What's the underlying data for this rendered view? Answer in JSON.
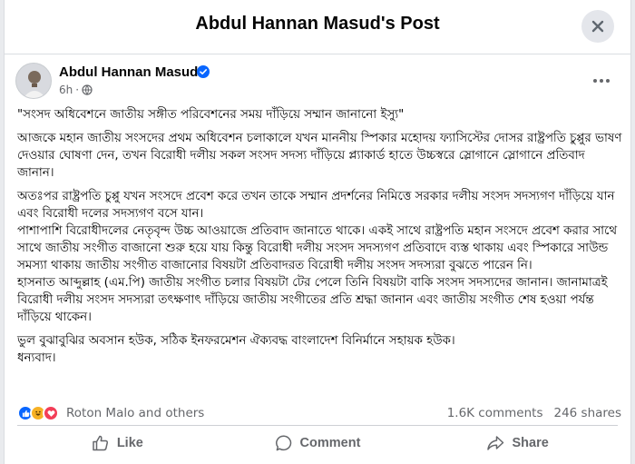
{
  "dialog": {
    "title": "Abdul Hannan Masud's Post"
  },
  "post": {
    "author": "Abdul Hannan Masud",
    "time": "6h",
    "paragraphs": [
      "\"সংসদ অধিবেশনে জাতীয় সঙ্গীত পরিবেশনের সময় দাঁড়িয়ে সম্মান জানানো ইস্যু\"",
      "আজকে মহান জাতীয় সংসদের প্রথম অধিবেশন চলাকালে যখন মাননীয় স্পিকার মহোদয় ফ্যাসিস্টের দোসর রাষ্ট্রপতি চুপ্পুর ভাষণ দেওয়ার ঘোষণা দেন, তখন বিরোধী দলীয় সকল সংসদ সদস্য দাঁড়িয়ে প্ল্যাকার্ড হাতে উচ্চস্বরে স্লোগানে স্লোগানে প্রতিবাদ জানান।",
      "অতঃপর রাষ্ট্রপতি চুপ্পু যখন সংসদে প্রবেশ করে তখন তাকে সম্মান প্রদর্শনের নিমিত্তে সরকার দলীয় সংসদ সদস্যগণ দাঁড়িয়ে যান এবং বিরোধী দলের সদস্যগণ বসে যান।",
      "পাশাপাশি বিরোধীদলের নেতৃবৃন্দ উচ্চ আওয়াজে প্রতিবাদ জানাতে থাকে। একই সাথে রাষ্ট্রপতি মহান সংসদে প্রবেশ করার সাথে সাথে জাতীয় সংগীত বাজানো শুরু হয়ে যায় কিন্তু বিরোধী দলীয় সংসদ সদস্যগণ প্রতিবাদে ব্যস্ত থাকায় এবং স্পিকারে সাউন্ড সমস্যা থাকায় জাতীয় সংগীত বাজানোর বিষয়টা প্রতিবাদরত বিরোধী দলীয় সংসদ সদস্যরা বুঝতে পারেন নি।",
      " হাসনাত আব্দুল্লাহ (এম.পি) জাতীয় সংগীত চলার বিষয়টা টের পেলে তিনি বিষয়টা বাকি সংসদ সদস্যদের জানান। জানামাত্রই বিরোধী দলীয় সংসদ সদস্যরা তৎক্ষণাৎ দাঁড়িয়ে জাতীয় সংগীতের প্রতি শ্রদ্ধা জানান এবং জাতীয় সংগীত শেষ হওয়া পর্যন্ত দাঁড়িয়ে থাকেন।",
      "ভুল বুঝাবুঝির অবসান হউক, সঠিক ইনফরমেশন ঐক্যবদ্ধ বাংলাদেশ বিনির্মানে সহায়ক হউক।",
      "ধন্যবাদ।"
    ]
  },
  "reactions": {
    "names": "Roton Malo and others",
    "comments": "1.6K comments",
    "shares": "246 shares"
  },
  "actions": {
    "like": "Like",
    "comment": "Comment",
    "share": "Share"
  },
  "colors": {
    "brand_blue": "#0866ff",
    "muted": "#65676b"
  }
}
